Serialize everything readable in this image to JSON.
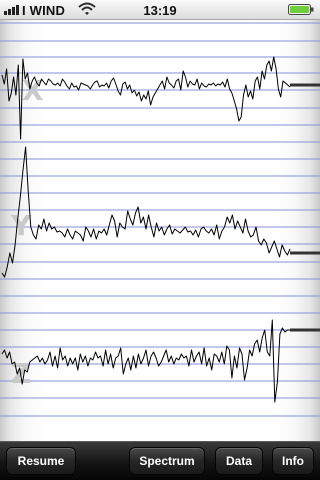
{
  "status_bar": {
    "carrier": "I WIND",
    "time": "13:19",
    "signal_icon": "signal-strength-icon",
    "wifi_icon": "wifi-icon",
    "battery_icon": "battery-icon"
  },
  "graphs": [
    {
      "axis": "X",
      "values": [
        12,
        3,
        18,
        -14,
        -6,
        10,
        -8,
        22,
        -52,
        28,
        8,
        14,
        -2,
        6,
        10,
        4,
        1,
        8,
        5,
        2,
        8,
        6,
        3,
        2,
        4,
        1,
        8,
        5,
        1,
        -2,
        4,
        0,
        1,
        -3,
        4,
        3,
        2,
        1,
        -2,
        2,
        5,
        6,
        0,
        2,
        1,
        4,
        -1,
        6,
        9,
        3,
        -4,
        -8,
        3,
        5,
        -2,
        2,
        -6,
        -3,
        -9,
        -5,
        -14,
        -8,
        -12,
        -4,
        -18,
        -10,
        -6,
        -2,
        2,
        6,
        -2,
        10,
        4,
        2,
        -1,
        6,
        8,
        -3,
        16,
        10,
        0,
        6,
        3,
        2,
        8,
        -2,
        4,
        1,
        0,
        3,
        2,
        4,
        1,
        3,
        2,
        5,
        0,
        8,
        -2,
        -6,
        -14,
        -22,
        -34,
        -30,
        -8,
        2,
        -10,
        -4,
        -12,
        6,
        10,
        -2,
        16,
        8,
        22,
        26,
        16,
        30,
        18,
        -2,
        -10,
        6,
        4,
        2,
        0
      ],
      "end_value": 2
    },
    {
      "axis": "Y",
      "values": [
        -40,
        -44,
        -34,
        -20,
        -30,
        -12,
        14,
        36,
        62,
        86,
        42,
        6,
        -2,
        -6,
        8,
        4,
        14,
        2,
        10,
        4,
        6,
        1,
        2,
        0,
        -4,
        4,
        -2,
        -6,
        2,
        0,
        -2,
        -8,
        6,
        2,
        -4,
        4,
        -6,
        2,
        0,
        4,
        -2,
        8,
        18,
        12,
        -4,
        10,
        6,
        4,
        22,
        14,
        8,
        20,
        26,
        10,
        16,
        4,
        18,
        6,
        -4,
        10,
        2,
        6,
        -2,
        4,
        8,
        -1,
        4,
        2,
        0,
        3,
        6,
        1,
        2,
        -2,
        3,
        -4,
        4,
        6,
        2,
        0,
        4,
        -2,
        8,
        -6,
        2,
        6,
        16,
        10,
        18,
        4,
        12,
        6,
        0,
        14,
        2,
        -4,
        -2,
        6,
        -8,
        -12,
        -6,
        -10,
        -20,
        -14,
        -8,
        -16,
        -24,
        -12,
        -18,
        -22,
        -16
      ],
      "end_value": -20
    },
    {
      "axis": "Z",
      "values": [
        6,
        10,
        2,
        8,
        -4,
        -2,
        -14,
        -8,
        -24,
        -10,
        -12,
        -2,
        0,
        2,
        4,
        -2,
        2,
        -4,
        0,
        8,
        -6,
        4,
        -8,
        12,
        0,
        4,
        -6,
        2,
        -4,
        2,
        -10,
        6,
        -2,
        4,
        -6,
        2,
        0,
        8,
        2,
        4,
        -6,
        10,
        -4,
        6,
        -8,
        2,
        4,
        12,
        -14,
        -4,
        2,
        -10,
        4,
        -8,
        6,
        -4,
        2,
        10,
        -6,
        4,
        8,
        2,
        -6,
        -2,
        4,
        10,
        -2,
        4,
        -4,
        2,
        0,
        6,
        2,
        4,
        -6,
        10,
        -2,
        4,
        8,
        -4,
        12,
        -6,
        2,
        -10,
        6,
        4,
        -2,
        8,
        -4,
        14,
        10,
        -18,
        4,
        -8,
        12,
        6,
        -20,
        -8,
        10,
        4,
        16,
        20,
        8,
        22,
        30,
        8,
        4,
        40,
        -42,
        -22,
        26,
        32,
        28,
        30,
        30
      ],
      "end_value": 30
    }
  ],
  "toolbar": {
    "resume_label": "Resume",
    "spectrum_label": "Spectrum",
    "data_label": "Data",
    "info_label": "Info"
  }
}
